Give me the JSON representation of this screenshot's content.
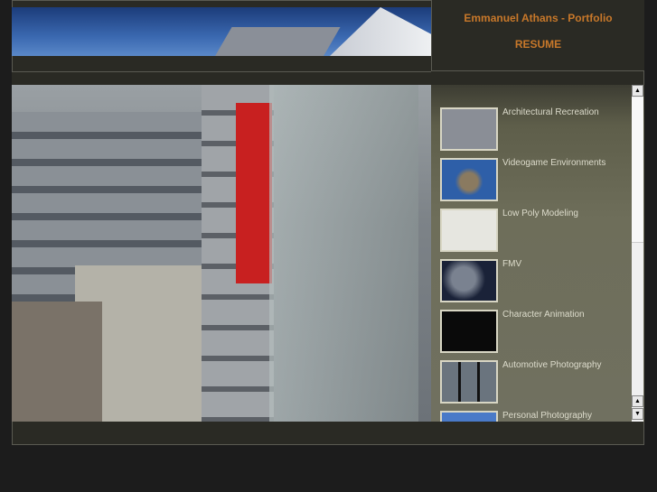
{
  "header": {
    "title": "Emmanuel Athans - Portfolio",
    "resume_link": "RESUME"
  },
  "portfolio": {
    "items": [
      {
        "label": "Architectural Recreation",
        "thumb_color": "#8a8e96"
      },
      {
        "label": "Videogame Environments",
        "thumb_color": "#2e5fa8"
      },
      {
        "label": "Low Poly Modeling",
        "thumb_color": "#e6e6e0"
      },
      {
        "label": "FMV",
        "thumb_color": "#1a2238"
      },
      {
        "label": "Character Animation",
        "thumb_color": "#0a0a0a"
      },
      {
        "label": "Automotive Photography",
        "thumb_color": "#2a323a"
      },
      {
        "label": "Personal Photography",
        "thumb_color": "#4a7ac8"
      }
    ]
  },
  "colors": {
    "accent": "#c8782a",
    "panel": "#6e6e5a",
    "background": "#1c1c1c"
  }
}
